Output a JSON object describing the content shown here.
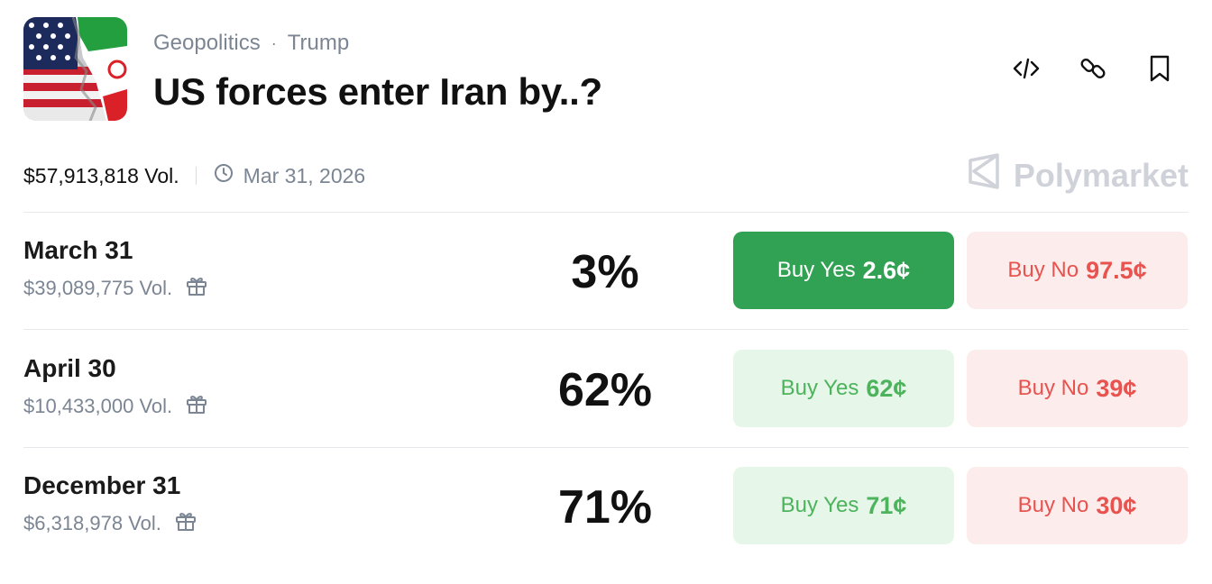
{
  "header": {
    "category": "Geopolitics",
    "separator": "·",
    "tag": "Trump",
    "title": "US forces enter Iran by..?"
  },
  "actions": [
    {
      "icon": "code-icon"
    },
    {
      "icon": "link-icon"
    },
    {
      "icon": "bookmark-icon"
    }
  ],
  "meta": {
    "volume": "$57,913,818 Vol.",
    "end_date": "Mar 31, 2026"
  },
  "brand": {
    "name": "Polymarket"
  },
  "colors": {
    "yes_solid": "#31a153",
    "yes_light": "#e6f6e8",
    "yes_text": "#4db35c",
    "no_light": "#fdecec",
    "no_text": "#e8534f"
  },
  "markets": [
    {
      "label": "March 31",
      "volume": "$39,089,775 Vol.",
      "percent": "3%",
      "yes_label": "Buy Yes",
      "yes_price": "2.6¢",
      "no_label": "Buy No",
      "no_price": "97.5¢",
      "yes_selected": true
    },
    {
      "label": "April 30",
      "volume": "$10,433,000 Vol.",
      "percent": "62%",
      "yes_label": "Buy Yes",
      "yes_price": "62¢",
      "no_label": "Buy No",
      "no_price": "39¢",
      "yes_selected": false
    },
    {
      "label": "December 31",
      "volume": "$6,318,978 Vol.",
      "percent": "71%",
      "yes_label": "Buy Yes",
      "yes_price": "71¢",
      "no_label": "Buy No",
      "no_price": "30¢",
      "yes_selected": false
    }
  ]
}
